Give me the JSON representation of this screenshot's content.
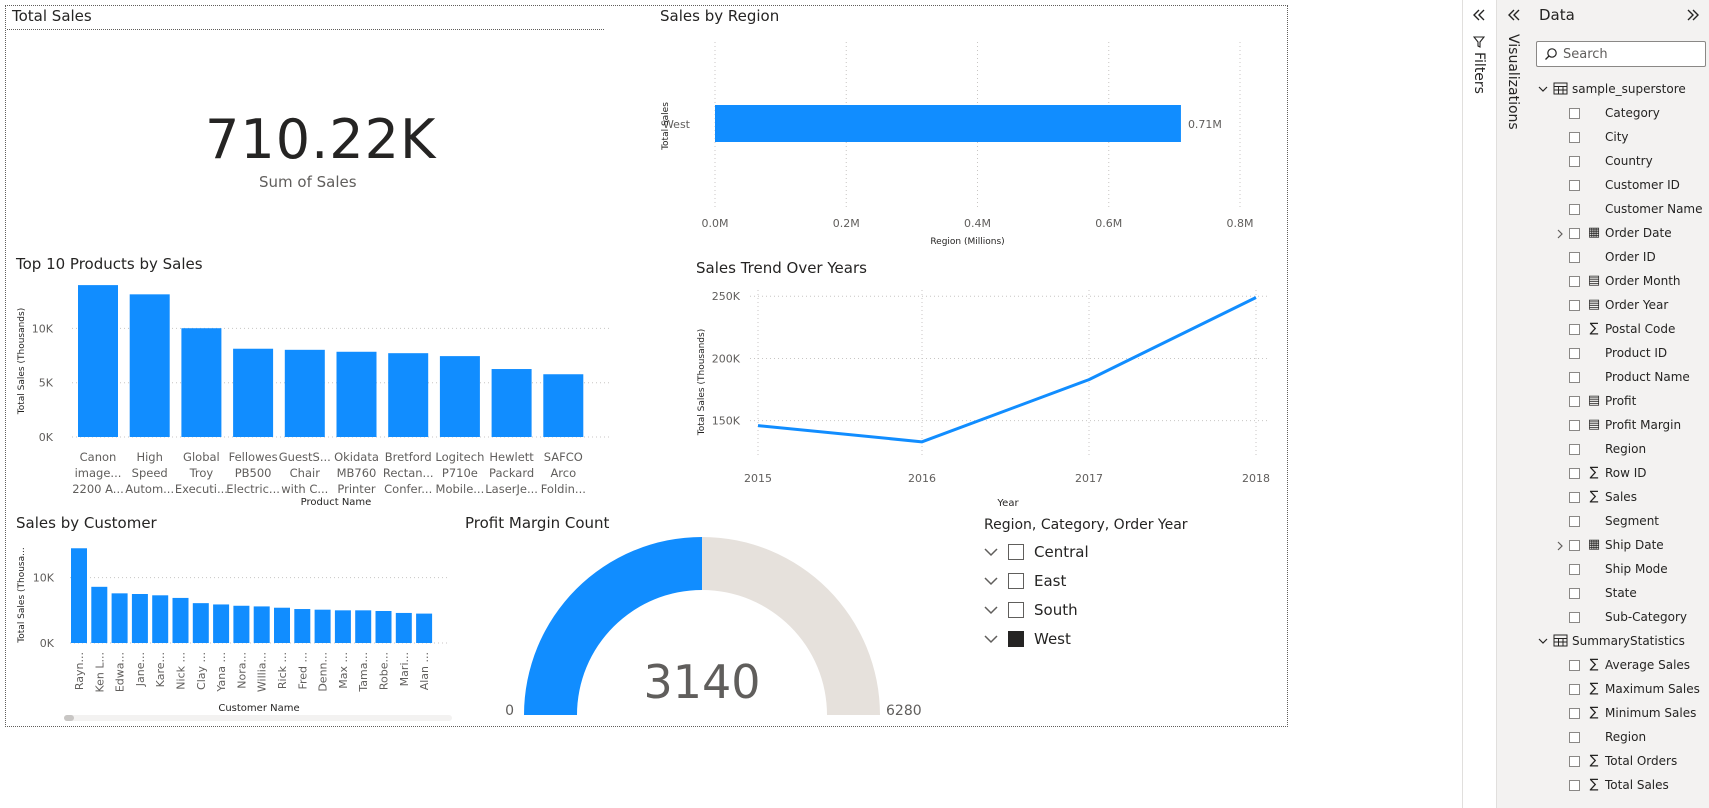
{
  "card": {
    "title": "Total Sales",
    "value": "710.22K",
    "label": "Sum of Sales"
  },
  "region_chart_block": {
    "title": "Sales by Region",
    "chart_data": {
      "type": "bar",
      "orientation": "horizontal",
      "categories": [
        "West"
      ],
      "values": [
        0.71
      ],
      "data_labels": [
        "0.71M"
      ],
      "xlabel": "Region (Millions)",
      "ylabel": "Total Sales",
      "xlim": [
        0,
        0.8
      ],
      "ticks": [
        "0.0M",
        "0.2M",
        "0.4M",
        "0.6M",
        "0.8M"
      ],
      "grid": true
    }
  },
  "products_block": {
    "title": "Top 10 Products by Sales",
    "chart_data": {
      "type": "bar",
      "categories": [
        [
          "Canon",
          "image...",
          "2200 A..."
        ],
        [
          "High",
          "Speed",
          "Autom..."
        ],
        [
          "Global",
          "Troy",
          "Executi..."
        ],
        [
          "Fellowes",
          "PB500",
          "Electric..."
        ],
        [
          "GuestS...",
          "Chair",
          "with C..."
        ],
        [
          "Okidata",
          "MB760",
          "Printer"
        ],
        [
          "Bretford",
          "Rectan...",
          "Confer..."
        ],
        [
          "Logitech",
          "P710e",
          "Mobile..."
        ],
        [
          "Hewlett",
          "Packard",
          "LaserJe..."
        ],
        [
          "SAFCO",
          "Arco",
          "Foldin..."
        ]
      ],
      "values": [
        13.99,
        13.14,
        10.02,
        8.13,
        8.03,
        7.85,
        7.72,
        7.45,
        6.26,
        5.78
      ],
      "xlabel": "Product Name",
      "ylabel": "Total Sales (Thousands)",
      "ylim": [
        0,
        14
      ],
      "ticks": [
        "0K",
        "5K",
        "10K"
      ],
      "grid": true
    }
  },
  "trend_block": {
    "title": "Sales Trend Over Years",
    "chart_data": {
      "type": "line",
      "x": [
        "2015",
        "2016",
        "2017",
        "2018"
      ],
      "values": [
        146,
        133,
        183,
        249
      ],
      "xlabel": "Year",
      "ylabel": "Total Sales (Thousands)",
      "ylim": [
        120,
        255
      ],
      "ticks": [
        "150K",
        "200K",
        "250K"
      ],
      "grid": true
    }
  },
  "customer_block": {
    "title": "Sales by Customer",
    "chart_data": {
      "type": "bar",
      "categories": [
        "Rayn...",
        "Ken L...",
        "Edwa...",
        "Jane...",
        "Kare...",
        "Nick ...",
        "Clay ...",
        "Yana ...",
        "Nora...",
        "Willia...",
        "Rick ...",
        "Fred ...",
        "Denn...",
        "Max ...",
        "Tama...",
        "Robe...",
        "Mari...",
        "Alan ..."
      ],
      "values": [
        14.5,
        8.6,
        7.6,
        7.5,
        7.3,
        6.9,
        6.1,
        5.9,
        5.7,
        5.6,
        5.4,
        5.2,
        5.1,
        5.0,
        5.0,
        4.9,
        4.6,
        4.5
      ],
      "xlabel": "Customer Name",
      "ylabel": "Total Sales (Thousa...",
      "ylim": [
        0,
        15
      ],
      "ticks": [
        "0K",
        "10K"
      ],
      "grid": true
    }
  },
  "gauge_block": {
    "title": "Profit Margin Count",
    "value_label": "3140",
    "min_label": "0",
    "max_label": "6280",
    "chart_data": {
      "type": "gauge",
      "value": 3140,
      "min": 0,
      "max": 6280
    }
  },
  "slicer": {
    "title": "Region, Category, Order Year",
    "items": [
      {
        "label": "Central",
        "checked": false
      },
      {
        "label": "East",
        "checked": false
      },
      {
        "label": "South",
        "checked": false
      },
      {
        "label": "West",
        "checked": true
      }
    ]
  },
  "panes": {
    "filters_label": "Filters",
    "visualizations_label": "Visualizations",
    "data_title": "Data",
    "search_placeholder": "Search",
    "tables": [
      {
        "name": "sample_superstore",
        "fields": [
          {
            "name": "Category",
            "icon": ""
          },
          {
            "name": "City",
            "icon": ""
          },
          {
            "name": "Country",
            "icon": ""
          },
          {
            "name": "Customer ID",
            "icon": ""
          },
          {
            "name": "Customer Name",
            "icon": ""
          },
          {
            "name": "Order Date",
            "icon": "calendar",
            "expandable": true
          },
          {
            "name": "Order ID",
            "icon": ""
          },
          {
            "name": "Order Month",
            "icon": "calc-table"
          },
          {
            "name": "Order Year",
            "icon": "calc-table"
          },
          {
            "name": "Postal Code",
            "icon": "sigma"
          },
          {
            "name": "Product ID",
            "icon": ""
          },
          {
            "name": "Product Name",
            "icon": ""
          },
          {
            "name": "Profit",
            "icon": "calc-table"
          },
          {
            "name": "Profit Margin",
            "icon": "calc-table"
          },
          {
            "name": "Region",
            "icon": ""
          },
          {
            "name": "Row ID",
            "icon": "sigma"
          },
          {
            "name": "Sales",
            "icon": "sigma"
          },
          {
            "name": "Segment",
            "icon": ""
          },
          {
            "name": "Ship Date",
            "icon": "calendar",
            "expandable": true
          },
          {
            "name": "Ship Mode",
            "icon": ""
          },
          {
            "name": "State",
            "icon": ""
          },
          {
            "name": "Sub-Category",
            "icon": ""
          }
        ]
      },
      {
        "name": "SummaryStatistics",
        "fields": [
          {
            "name": "Average Sales",
            "icon": "sigma"
          },
          {
            "name": "Maximum Sales",
            "icon": "sigma"
          },
          {
            "name": "Minimum Sales",
            "icon": "sigma"
          },
          {
            "name": "Region",
            "icon": ""
          },
          {
            "name": "Total Orders",
            "icon": "sigma"
          },
          {
            "name": "Total Sales",
            "icon": "sigma"
          }
        ]
      }
    ]
  },
  "colors": {
    "accent": "#118dff",
    "gauge_track": "#e6e1dc",
    "text": "#252423",
    "grid": "#c8c6c4"
  }
}
